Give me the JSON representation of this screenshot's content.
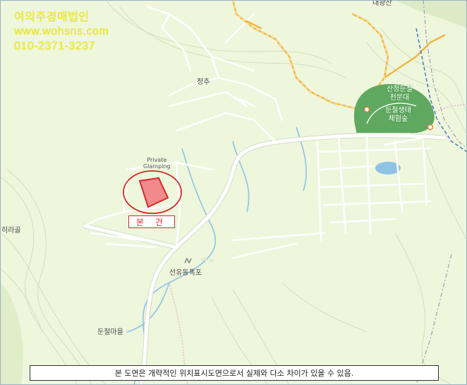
{
  "watermark": {
    "company": "여의주경매법인",
    "website": "www.wohsns.com",
    "phone": "010-2371-3237"
  },
  "map_labels": {
    "top_cut": "대광산",
    "jeongchu": "정추",
    "private_glamping": "Private\nGlamping",
    "hiragol": "히라골",
    "seonyu_dongpokpo": "선유동폭포",
    "dunjeol_maeul": "둔철마을",
    "sancheong_observatory": "산청둔철\n천문대",
    "dunjeol_eco_forest": "둔철생태\n체험숲"
  },
  "subject": {
    "label": "본 건"
  },
  "disclaimer": "본 도면은 개략적인 위치표시도면으로서 실제와 다소 차이가 있을 수 있음.",
  "colors": {
    "land": "#eef6dc",
    "road": "#ffffff",
    "highway": "#f3b640",
    "water": "#8fc3e6",
    "forest": "#5fa860",
    "subject": "#d4282a",
    "watermark": "#f2ee3a"
  }
}
